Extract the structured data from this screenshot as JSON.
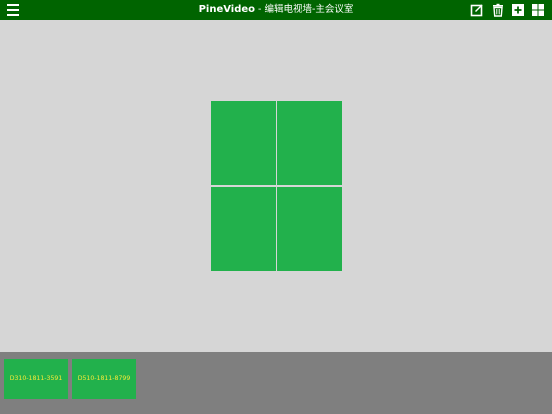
{
  "header": {
    "app_name": "PineVideo",
    "separator": "-",
    "page_title": "编辑电视墙-主会议室",
    "background_color": "#006400",
    "icons": {
      "menu": "hamburger-menu-icon",
      "edit": "edit-icon",
      "delete": "trash-icon",
      "add": "add-icon",
      "layout": "grid-layout-icon"
    }
  },
  "wall": {
    "rows": 2,
    "columns": 2,
    "screen_color": "#22b14c",
    "background_color": "#d6d6d6"
  },
  "devices": [
    {
      "label": "D310-1811-3591"
    },
    {
      "label": "D510-1811-8799"
    }
  ],
  "device_tray": {
    "background_color": "#7f7f7f",
    "label_color": "#f3e93a"
  }
}
